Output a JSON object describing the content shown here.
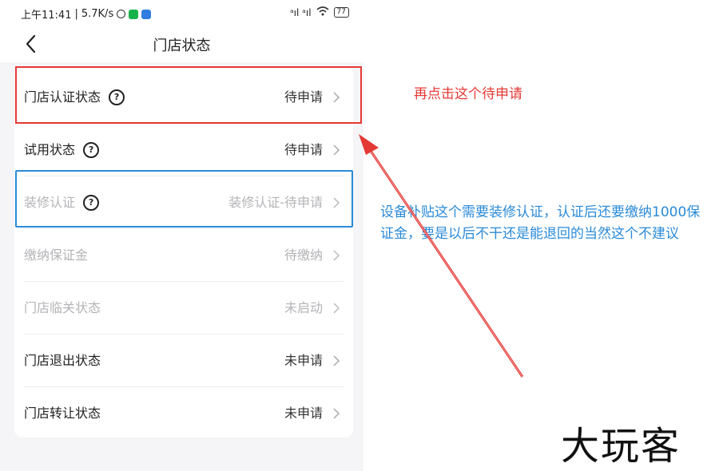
{
  "status_bar": {
    "time": "上午11:41",
    "speed": "5.7K/s",
    "signal": "ᵃıl ᵃıl",
    "battery": "77"
  },
  "nav": {
    "title": "门店状态",
    "back_icon": "chevron-left-icon"
  },
  "rows": [
    {
      "label": "门店认证状态",
      "value": "待申请",
      "has_help": true,
      "disabled": false
    },
    {
      "label": "试用状态",
      "value": "待申请",
      "has_help": true,
      "disabled": false
    },
    {
      "label": "装修认证",
      "value": "装修认证-待申请",
      "has_help": true,
      "disabled": true
    },
    {
      "label": "缴纳保证金",
      "value": "待缴纳",
      "has_help": false,
      "disabled": true
    },
    {
      "label": "门店临关状态",
      "value": "未启动",
      "has_help": false,
      "disabled": true
    },
    {
      "label": "门店退出状态",
      "value": "未申请",
      "has_help": false,
      "disabled": false
    },
    {
      "label": "门店转让状态",
      "value": "未申请",
      "has_help": false,
      "disabled": false
    }
  ],
  "annotations": {
    "red_note": "再点击这个待申请",
    "blue_note": "设备补贴这个需要装修认证，认证后还要缴纳1000保证金，要是以后不干还是能退回的当然这个不建议"
  },
  "colors": {
    "red": "#e53935",
    "blue": "#2a8ad8",
    "disabled": "#b4b4b8"
  },
  "watermark": "大玩客"
}
